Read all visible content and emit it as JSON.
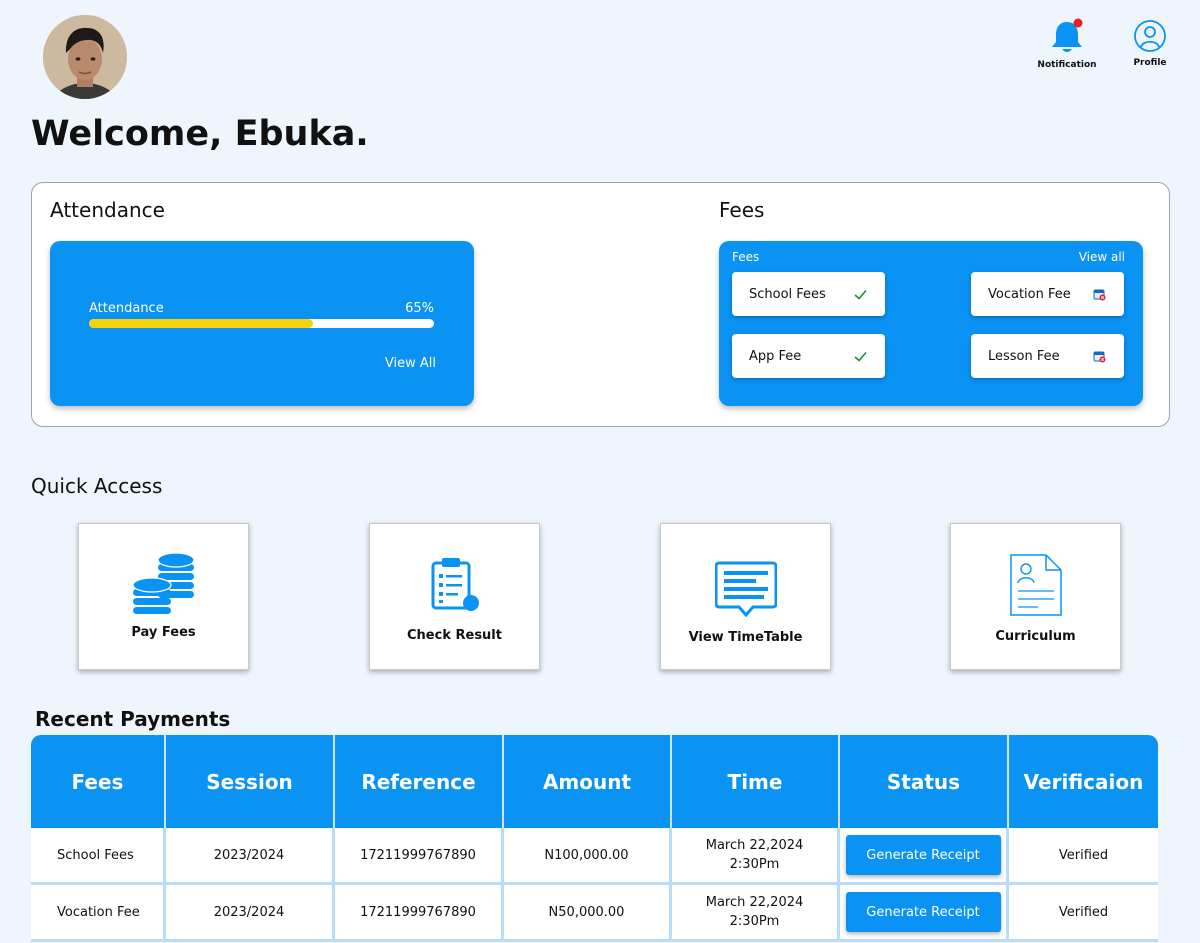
{
  "header": {
    "welcome": "Welcome, Ebuka.",
    "notification_label": "Notification",
    "profile_label": "Profile"
  },
  "attendance": {
    "section_title": "Attendance",
    "label": "Attendance",
    "percent_text": "65%",
    "percent_value": 65,
    "view_all": "View All"
  },
  "fees": {
    "section_title": "Fees",
    "card_label": "Fees",
    "view_all": "View all",
    "items": [
      {
        "label": "School Fees",
        "status": "paid",
        "icon": "check-icon"
      },
      {
        "label": "Vocation Fee",
        "status": "unpaid",
        "icon": "calendar-x-icon"
      },
      {
        "label": "App Fee",
        "status": "paid",
        "icon": "check-icon"
      },
      {
        "label": "Lesson Fee",
        "status": "unpaid",
        "icon": "calendar-x-icon"
      }
    ]
  },
  "quick_access": {
    "title": "Quick Access",
    "tiles": [
      {
        "label": "Pay Fees",
        "icon": "coins-icon"
      },
      {
        "label": "Check Result",
        "icon": "clipboard-icon"
      },
      {
        "label": "View TimeTable",
        "icon": "message-list-icon"
      },
      {
        "label": "Curriculum",
        "icon": "document-user-icon"
      }
    ]
  },
  "recent_payments": {
    "title": "Recent Payments",
    "columns": [
      "Fees",
      "Session",
      "Reference",
      "Amount",
      "Time",
      "Status",
      "Verificaion"
    ],
    "rows": [
      {
        "fee": "School Fees",
        "session": "2023/2024",
        "reference": "17211999767890",
        "amount": "N100,000.00",
        "time_date": "March 22,2024",
        "time_hour": "2:30Pm",
        "status": "Generate Receipt",
        "verification": "Verified"
      },
      {
        "fee": "Vocation Fee",
        "session": "2023/2024",
        "reference": "17211999767890",
        "amount": "N50,000.00",
        "time_date": "March 22,2024",
        "time_hour": "2:30Pm",
        "status": "Generate Receipt",
        "verification": "Verified"
      }
    ]
  },
  "colors": {
    "primary": "#0a93f3",
    "background": "#eef5fd",
    "progress": "#f6d10c",
    "notification_dot": "#e8202a"
  }
}
